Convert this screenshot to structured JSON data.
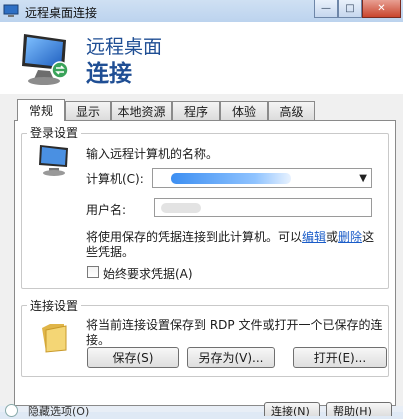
{
  "window": {
    "title": "远程桌面连接",
    "buttons": {
      "minimize": "—",
      "maximize": "□",
      "close": "✕"
    }
  },
  "header": {
    "line1": "远程桌面",
    "line2": "连接"
  },
  "tabs": [
    {
      "label": "常规",
      "active": true
    },
    {
      "label": "显示",
      "active": false
    },
    {
      "label": "本地资源",
      "active": false
    },
    {
      "label": "程序",
      "active": false
    },
    {
      "label": "体验",
      "active": false
    },
    {
      "label": "高级",
      "active": false
    }
  ],
  "login_settings": {
    "title": "登录设置",
    "instruction": "输入远程计算机的名称。",
    "computer_label": "计算机(C):",
    "username_label": "用户名:",
    "saved_creds_text_1": "将使用保存的凭据连接到此计算机。可以",
    "edit_link": "编辑",
    "or_text": "或",
    "delete_link": "删除",
    "saved_creds_text_2": "这",
    "saved_creds_text_3": "些凭据。",
    "always_ask_label": "始终要求凭据(A)",
    "always_ask_checked": false
  },
  "connection_settings": {
    "title": "连接设置",
    "description_1": "将当前连接设置保存到 RDP 文件或打开一个已保存的连",
    "description_2": "接。",
    "save_button": "保存(S)",
    "save_as_button": "另存为(V)...",
    "open_button": "打开(E)..."
  },
  "footer": {
    "options_text": "隐藏选项(O)",
    "connect_button": "连接(N)",
    "help_button": "帮助(H)"
  },
  "colors": {
    "header_text": "#1f4e94",
    "link": "#1a5cc8",
    "title_bar": "#cfe0f3"
  }
}
